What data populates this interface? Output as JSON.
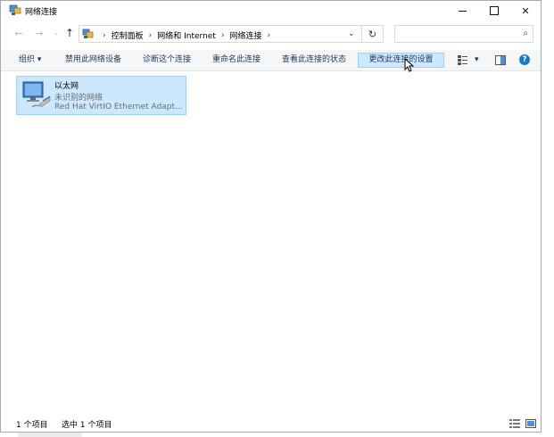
{
  "window": {
    "title": "网络连接"
  },
  "address": {
    "crumbs": [
      "控制面板",
      "网络和 Internet",
      "网络连接"
    ],
    "search_placeholder": ""
  },
  "toolbar": {
    "organize": "组织 ▾",
    "disable": "禁用此网络设备",
    "diagnose": "诊断这个连接",
    "rename": "重命名此连接",
    "view_status": "查看此连接的状态",
    "change_settings": "更改此连接的设置",
    "help": "?"
  },
  "connection": {
    "name": "以太网",
    "status": "未识别的网络",
    "adapter": "Red Hat VirtIO Ethernet Adapt..."
  },
  "statusbar": {
    "count": "1 个项目",
    "selected": "选中 1 个项目"
  },
  "colors": {
    "selection_bg": "#cce8ff",
    "selection_border": "#99d1ff",
    "command_text": "#1e395b",
    "help_blue": "#1979ca"
  }
}
